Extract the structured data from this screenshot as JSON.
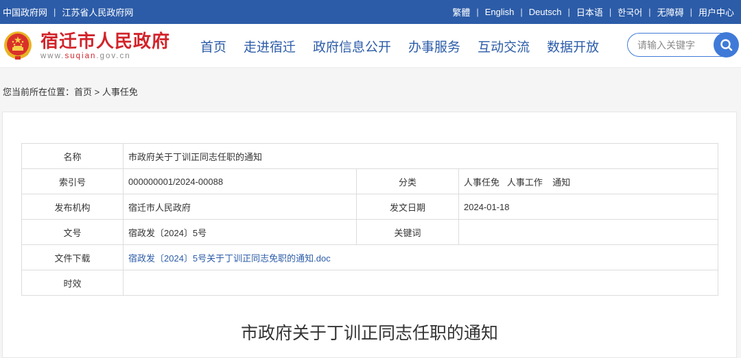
{
  "topbar": {
    "left_links": [
      "中国政府网",
      "江苏省人民政府网"
    ],
    "right_links": [
      "繁體",
      "English",
      "Deutsch",
      "日本语",
      "한국어",
      "无障碍",
      "用户中心"
    ],
    "separator": "|"
  },
  "header": {
    "site_name": "宿迁市人民政府",
    "url_prefix": "www.",
    "url_highlight": "suqian",
    "url_suffix": ".gov.cn",
    "emblem_icon": "national-emblem"
  },
  "nav": {
    "items": [
      "首页",
      "走进宿迁",
      "政府信息公开",
      "办事服务",
      "互动交流",
      "数据开放"
    ]
  },
  "search": {
    "placeholder": "请输入关键字",
    "value": "",
    "icon": "search-icon"
  },
  "breadcrumb": {
    "prefix": "您当前所在位置：",
    "items": [
      "首页",
      "人事任免"
    ],
    "separator": ">"
  },
  "info_table": {
    "name_label": "名称",
    "name_value": "市政府关于丁训正同志任职的通知",
    "index_label": "索引号",
    "index_value": "000000001/2024-00088",
    "category_label": "分类",
    "category_value": "人事任免   人事工作    通知",
    "publisher_label": "发布机构",
    "publisher_value": "宿迁市人民政府",
    "date_label": "发文日期",
    "date_value": "2024-01-18",
    "docno_label": "文号",
    "docno_value": "宿政发〔2024〕5号",
    "keywords_label": "关键词",
    "keywords_value": "",
    "download_label": "文件下载",
    "download_link": "宿政发〔2024〕5号关于丁训正同志免职的通知.doc",
    "validity_label": "时效",
    "validity_value": ""
  },
  "document": {
    "title": "市政府关于丁训正同志任职的通知"
  },
  "colors": {
    "brand_blue": "#2c5ca8",
    "brand_red": "#d2232a",
    "search_blue": "#3f7ad8"
  }
}
